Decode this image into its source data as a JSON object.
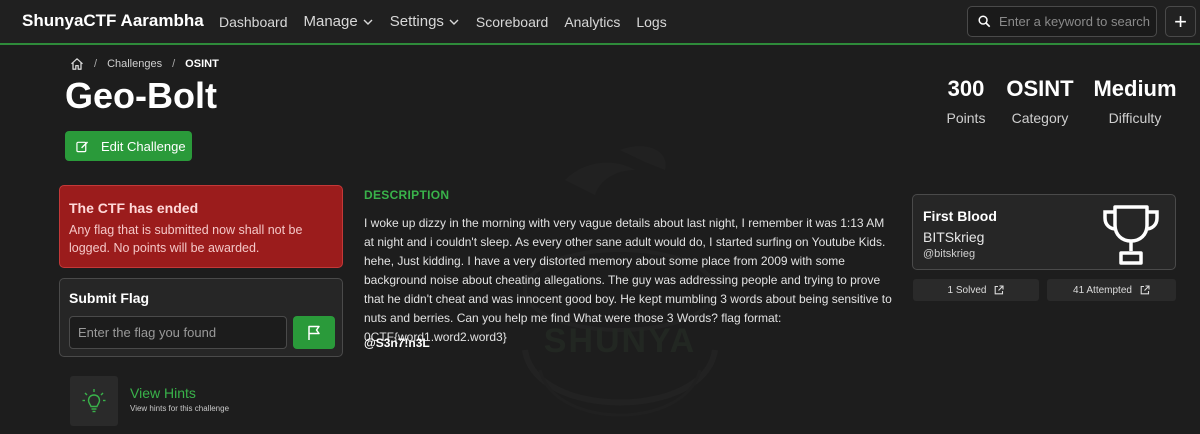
{
  "navbar": {
    "brand": "ShunyaCTF Aarambha",
    "items": [
      {
        "label": "Dashboard"
      },
      {
        "label": "Manage"
      },
      {
        "label": "Settings"
      },
      {
        "label": "Scoreboard"
      },
      {
        "label": "Analytics"
      },
      {
        "label": "Logs"
      }
    ],
    "search_placeholder": "Enter a keyword to search",
    "add_label": "+"
  },
  "breadcrumb": {
    "items": [
      "Challenges",
      "OSINT"
    ],
    "separator": "/"
  },
  "challenge": {
    "title": "Geo-Bolt",
    "edit_label": "Edit Challenge",
    "stats": [
      {
        "value": "300",
        "label": "Points"
      },
      {
        "value": "OSINT",
        "label": "Category"
      },
      {
        "value": "Medium",
        "label": "Difficulty"
      }
    ],
    "description_heading": "DESCRIPTION",
    "description": "I woke up dizzy in the morning with very vague details about last night, I remember it was 1:13 AM at night and i couldn't sleep. As every other sane adult would do, I started surfing on Youtube Kids. hehe, Just kidding. I have a very distorted memory about some place from 2009 with some background noise about cheating allegations. The guy was addressing people and trying to prove that he didn't cheat and was innocent good boy. He kept mumbling 3 words about being sensitive to nuts and berries. Can you help me find What were those 3 Words? flag format: 0CTF{word1.word2.word3}",
    "author": "@S3n7!n3L"
  },
  "alert": {
    "heading": "The CTF has ended",
    "body": "Any flag that is submitted now shall not be logged. No points will be awarded."
  },
  "submit_flag": {
    "heading": "Submit Flag",
    "placeholder": "Enter the flag you found"
  },
  "hints": {
    "title": "View Hints",
    "subtitle": "View hints for this challenge"
  },
  "first_blood": {
    "heading": "First Blood",
    "name": "BITSkrieg",
    "handle": "@bitskrieg",
    "solved_label": "1 Solved",
    "attempted_label": "41 Attempted"
  },
  "watermark": {
    "text": "SHUNYA"
  },
  "colors": {
    "accent": "#2a9a3a",
    "alert_bg": "#9b1c1c",
    "background": "#1d1d1d"
  }
}
